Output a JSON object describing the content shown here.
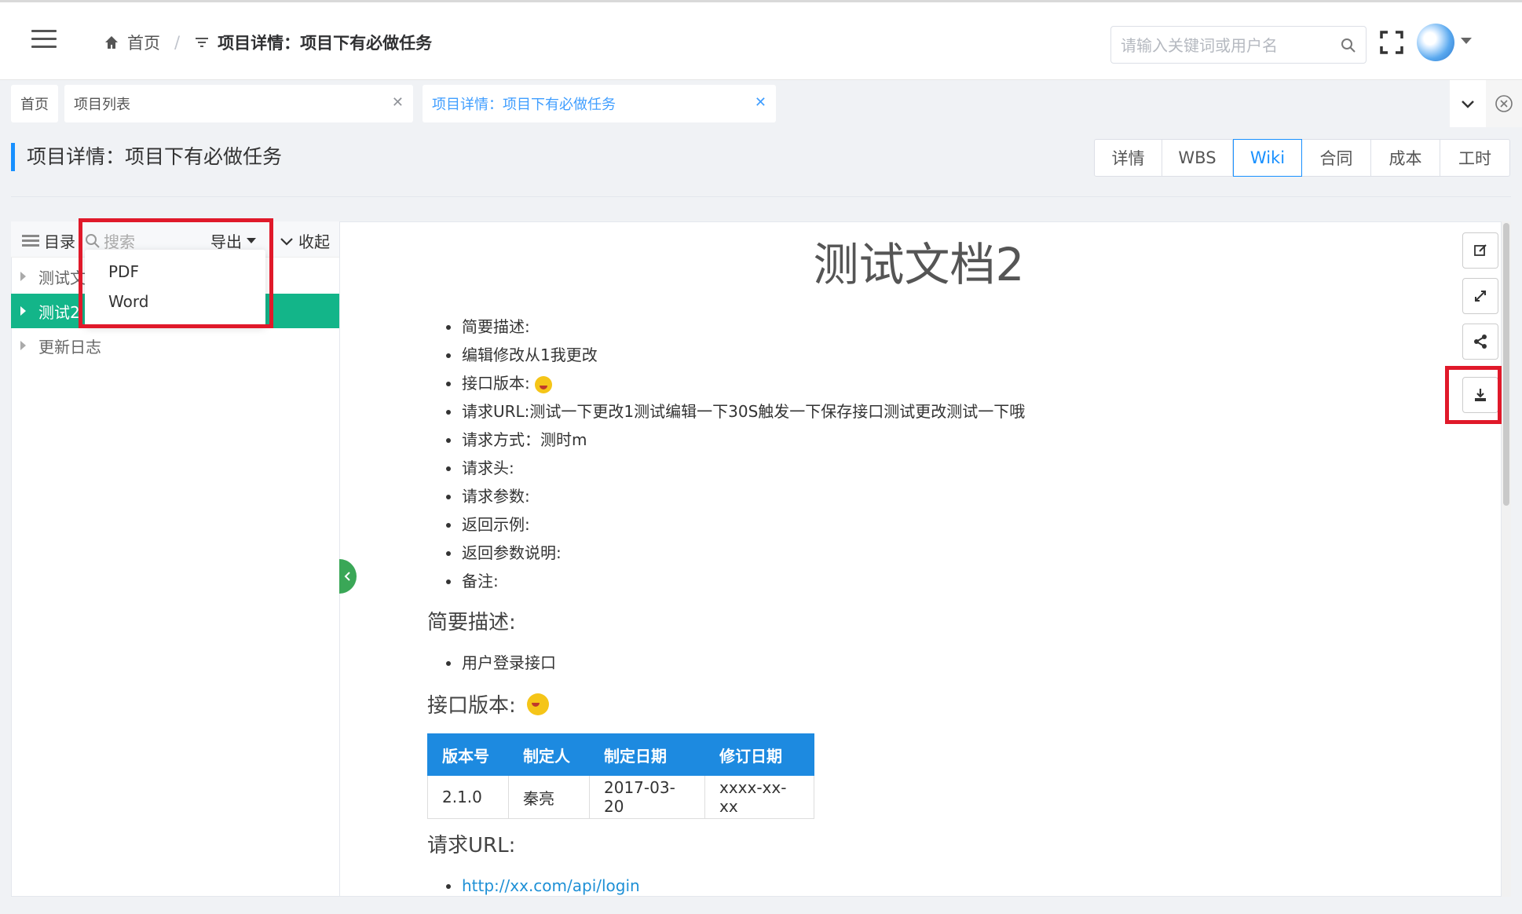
{
  "header": {
    "breadcrumb_home": "首页",
    "breadcrumb_current": "项目详情：项目下有必做任务",
    "search_placeholder": "请输入关键词或用户名"
  },
  "tabs": [
    {
      "label": "首页"
    },
    {
      "label": "项目列表"
    },
    {
      "label": "项目详情：项目下有必做任务"
    }
  ],
  "page_title": "项目详情：项目下有必做任务",
  "view_tabs": [
    "详情",
    "WBS",
    "Wiki",
    "合同",
    "成本",
    "工时"
  ],
  "active_view_tab": "Wiki",
  "sidebar": {
    "toc_label": "目录",
    "search_placeholder": "搜索",
    "export_label": "导出",
    "collapse_label": "收起",
    "tree": [
      {
        "label": "测试文"
      },
      {
        "label": "测试2"
      },
      {
        "label": "更新日志"
      }
    ],
    "export_menu": [
      "PDF",
      "Word"
    ]
  },
  "doc": {
    "title": "测试文档2",
    "toc_bullets": [
      "简要描述:",
      "编辑修改从1我更改",
      "接口版本:",
      "请求URL:测试一下更改1测试编辑一下30S触发一下保存接口测试更改测试一下哦",
      "请求方式：测时m",
      "请求头:",
      "请求参数:",
      "返回示例:",
      "返回参数说明:",
      "备注:"
    ],
    "section1_heading": "简要描述:",
    "section1_bullets": [
      "用户登录接口"
    ],
    "section2_heading": "接口版本:",
    "table": {
      "headers": [
        "版本号",
        "制定人",
        "制定日期",
        "修订日期"
      ],
      "rows": [
        [
          "2.1.0",
          "秦亮",
          "2017-03-20",
          "xxxx-xx-xx"
        ]
      ]
    },
    "section3_heading": "请求URL:",
    "url_link": "http://xx.com/api/login"
  },
  "colors": {
    "accent": "#1890ff",
    "tree_active": "#13b589",
    "table_header": "#1d8ae0",
    "highlight_box": "#e0192a"
  }
}
